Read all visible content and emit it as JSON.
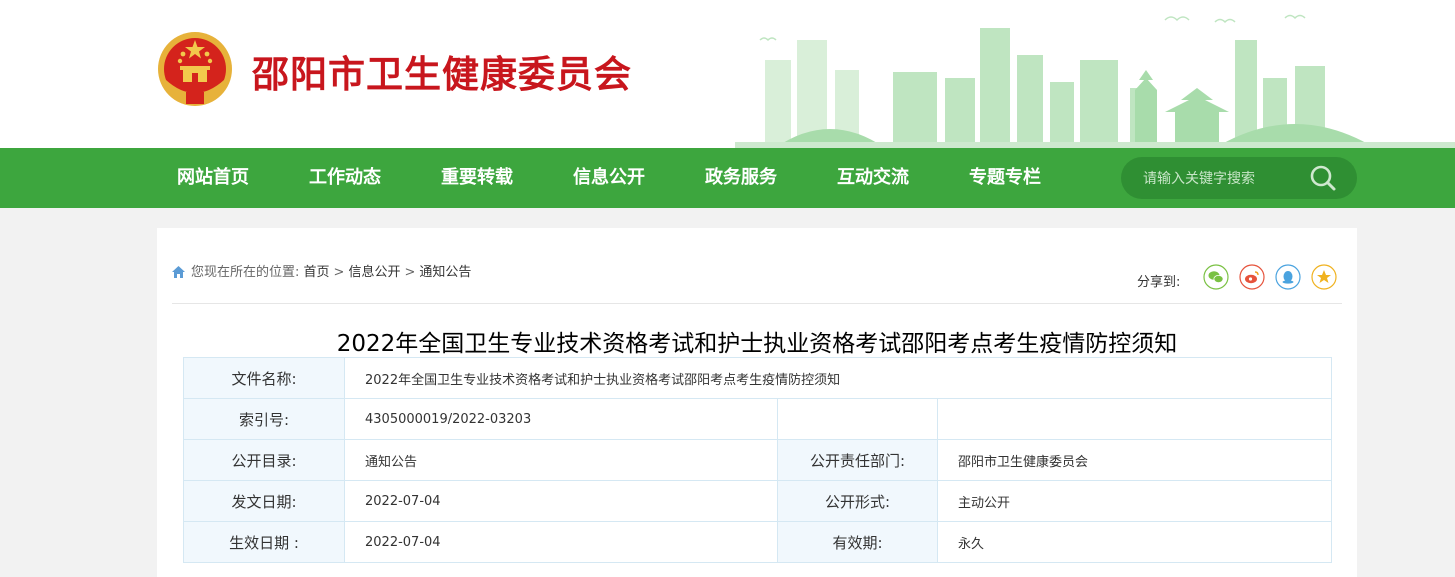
{
  "header": {
    "site_title": "邵阳市卫生健康委员会",
    "emblem_icon": "national-emblem-icon",
    "colors": {
      "title_red": "#c8161d",
      "nav_green": "#3da63e",
      "skyline_green": "#a8dcab"
    }
  },
  "nav": {
    "items": [
      "网站首页",
      "工作动态",
      "重要转载",
      "信息公开",
      "政务服务",
      "互动交流",
      "专题专栏"
    ],
    "search_placeholder": "请输入关键字搜索"
  },
  "breadcrumb": {
    "prefix": "您现在所在的位置:",
    "items": [
      "首页",
      "信息公开",
      "通知公告"
    ],
    "separator": ">"
  },
  "share": {
    "label": "分享到:",
    "icons": [
      "wechat-icon",
      "weibo-icon",
      "qq-icon",
      "qzone-icon"
    ]
  },
  "article": {
    "title": "2022年全国卫生专业技术资格考试和护士执业资格考试邵阳考点考生疫情防控须知"
  },
  "meta": {
    "file_name_label": "文件名称:",
    "file_name": "2022年全国卫生专业技术资格考试和护士执业资格考试邵阳考点考生疫情防控须知",
    "index_label": "索引号:",
    "index": "4305000019/2022-03203",
    "catalog_label": "公开目录:",
    "catalog": "通知公告",
    "dept_label": "公开责任部门:",
    "dept": "邵阳市卫生健康委员会",
    "date_label": "发文日期:",
    "date": "2022-07-04",
    "form_label": "公开形式:",
    "form": "主动公开",
    "effective_label": "生效日期 :",
    "effective": "2022-07-04",
    "validity_label": "有效期:",
    "validity": "永久"
  }
}
